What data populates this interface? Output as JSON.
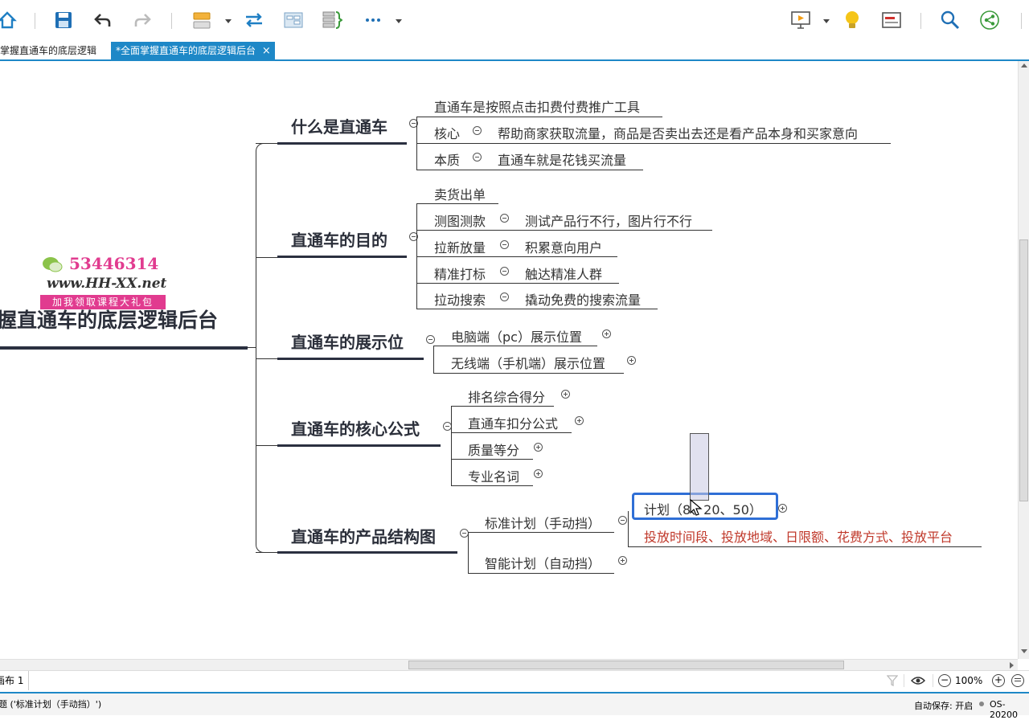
{
  "toolbar": {
    "icons": [
      "home-icon",
      "save-icon",
      "undo-icon",
      "redo-icon",
      "insert-topic-icon",
      "relationship-icon",
      "boundary-icon",
      "summary-icon",
      "more-icon",
      "presentation-icon",
      "idea-icon",
      "outline-icon",
      "search-icon",
      "share-icon"
    ]
  },
  "tabs": [
    {
      "label": "掌握直通车的底层逻辑"
    },
    {
      "label": "*全面掌握直通车的底层逻辑后台",
      "close": "×"
    }
  ],
  "watermark": {
    "qq": "53446314",
    "url": "www.HH-XX.net",
    "promo": "加我领取课程大礼包"
  },
  "map": {
    "central": "握直通车的底层逻辑后台",
    "branches": [
      {
        "title": "什么是直通车",
        "children": [
          {
            "label": "直通车是按照点击扣费付费推广工具"
          },
          {
            "label": "核心",
            "detail": "帮助商家获取流量，商品是否卖出去还是看产品本身和买家意向"
          },
          {
            "label": "本质",
            "detail": "直通车就是花钱买流量"
          }
        ]
      },
      {
        "title": "直通车的目的",
        "children": [
          {
            "label": "卖货出单"
          },
          {
            "label": "测图测款",
            "detail": "测试产品行不行，图片行不行"
          },
          {
            "label": "拉新放量",
            "detail": "积累意向用户"
          },
          {
            "label": "精准打标",
            "detail": "触达精准人群"
          },
          {
            "label": "拉动搜索",
            "detail": "撬动免费的搜索流量"
          }
        ]
      },
      {
        "title": "直通车的展示位",
        "children": [
          {
            "label": "电脑端（pc）展示位置"
          },
          {
            "label": "无线端（手机端）展示位置"
          }
        ]
      },
      {
        "title": "直通车的核心公式",
        "children": [
          {
            "label": "排名综合得分"
          },
          {
            "label": "直通车扣分公式"
          },
          {
            "label": "质量等分"
          },
          {
            "label": "专业名词"
          }
        ]
      },
      {
        "title": "直通车的产品结构图",
        "children": [
          {
            "label": "标准计划（手动挡）",
            "children": [
              {
                "label": "计划（8、20、50）"
              },
              {
                "label": "投放时间段、投放地域、日限额、花费方式、投放平台"
              }
            ]
          },
          {
            "label": "智能计划（自动挡）"
          }
        ]
      }
    ]
  },
  "bottombar": {
    "sheet": "画布 1",
    "zoom": "100%",
    "minus": "−",
    "plus": "+"
  },
  "statusbar": {
    "selection": "题 ('标准计划（手动挡）')",
    "autosave": "自动保存: 开启",
    "os": "OS-20200"
  },
  "colors": {
    "accent": "#1e88c7",
    "red_text": "#c0392b",
    "main_text": "#2b2f3a"
  }
}
